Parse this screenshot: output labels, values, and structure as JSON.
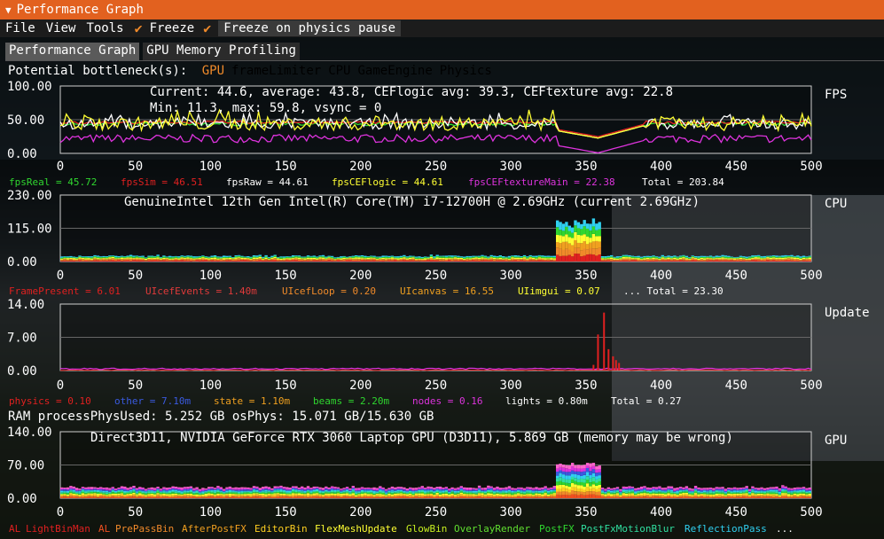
{
  "window": {
    "title": "Performance Graph"
  },
  "menu": {
    "file": "File",
    "view": "View",
    "tools": "Tools",
    "freeze": "Freeze",
    "freeze_physics": "Freeze on physics pause"
  },
  "tabs": [
    {
      "label": "Performance Graph"
    },
    {
      "label": "GPU Memory Profiling"
    }
  ],
  "bottleneck": {
    "label": "Potential bottleneck(s):",
    "items": [
      {
        "name": "GPU",
        "color": "#f08a2a"
      },
      {
        "name": "frameLimiter",
        "color": "#000000"
      },
      {
        "name": "CPU",
        "color": "#000000"
      },
      {
        "name": "GameEngine",
        "color": "#000000"
      },
      {
        "name": "Physics",
        "color": "#000000"
      }
    ]
  },
  "ram_line": "RAM  processPhysUsed: 5.252 GB  osPhys: 15.071 GB/15.630 GB",
  "graphs": [
    {
      "id": "fps",
      "side_label": "FPS",
      "ymax_label": "100.00",
      "ymid_label": "50.00",
      "ymin_label": "0.00",
      "ymax": 100,
      "info": [
        "Current: 44.6, average: 43.8, CEFlogic avg: 39.3, CEFtexture avg: 22.8",
        "Min: 11.3, max: 59.8, vsync = 0"
      ],
      "legend": [
        {
          "name": "fpsReal",
          "value": "45.72",
          "color": "#2fd62f"
        },
        {
          "name": "fpsSim",
          "value": "46.51",
          "color": "#e02020"
        },
        {
          "name": "fpsRaw",
          "value": "44.61",
          "color": "#ffffff"
        },
        {
          "name": "fpsCEFlogic",
          "value": "44.61",
          "color": "#ffff33"
        },
        {
          "name": "fpsCEFtextureMain",
          "value": "22.38",
          "color": "#dd33dd"
        }
      ],
      "total": "Total = 203.84"
    },
    {
      "id": "cpu",
      "side_label": "CPU",
      "ymax_label": "230.00",
      "ymid_label": "115.00",
      "ymin_label": "0.00",
      "ymax": 230,
      "info": [
        "GenuineIntel 12th Gen Intel(R) Core(TM) i7-12700H @ 2.69GHz (current 2.69GHz)"
      ],
      "legend": [
        {
          "name": "FramePresent",
          "value": "6.01",
          "color": "#e02020"
        },
        {
          "name": "UIcefEvents",
          "value": "1.40m",
          "color": "#e03a3a"
        },
        {
          "name": "UIcefLoop",
          "value": "0.20",
          "color": "#f08a2a"
        },
        {
          "name": "UIcanvas",
          "value": "16.55",
          "color": "#f0a020"
        },
        {
          "name": "UIimgui",
          "value": "0.07",
          "color": "#ffff33"
        }
      ],
      "total": "... Total = 23.30"
    },
    {
      "id": "update",
      "side_label": "Update",
      "ymax_label": "14.00",
      "ymid_label": "7.00",
      "ymin_label": "0.00",
      "ymax": 14,
      "info": [],
      "legend": [
        {
          "name": "physics",
          "value": "0.10",
          "color": "#e02020"
        },
        {
          "name": "other",
          "value": "7.10m",
          "color": "#3a5ae0"
        },
        {
          "name": "state",
          "value": "1.10m",
          "color": "#f0a020"
        },
        {
          "name": "beams",
          "value": "2.20m",
          "color": "#2fd62f"
        },
        {
          "name": "nodes",
          "value": "0.16",
          "color": "#dd33dd"
        },
        {
          "name": "lights",
          "value": "0.80m",
          "color": "#ffffff"
        }
      ],
      "total": "Total = 0.27"
    },
    {
      "id": "gpu",
      "side_label": "GPU",
      "ymax_label": "140.00",
      "ymid_label": "70.00",
      "ymin_label": "0.00",
      "ymax": 140,
      "info": [
        "Direct3D11, NVIDIA GeForce RTX 3060 Laptop GPU (D3D11), 5.869 GB (memory may be wrong)"
      ],
      "legend_names": [
        {
          "name": "AL",
          "color": "#e02020"
        },
        {
          "name": "LightBinMan",
          "color": "#e02020"
        },
        {
          "name": "AL",
          "color": "#f05020"
        },
        {
          "name": "PrePassBin",
          "color": "#f08a2a"
        },
        {
          "name": "AfterPostFX",
          "color": "#f0a020"
        },
        {
          "name": "EditorBin",
          "color": "#ffd020"
        },
        {
          "name": "FlexMeshUpdate",
          "color": "#ffff33"
        },
        {
          "name": "GlowBin",
          "color": "#c8f020"
        },
        {
          "name": "OverlayRender",
          "color": "#60e030"
        },
        {
          "name": "PostFX",
          "color": "#2fd62f"
        },
        {
          "name": "PostFxMotionBlur",
          "color": "#30e0a0"
        },
        {
          "name": "ReflectionPass",
          "color": "#30d0f0"
        }
      ],
      "more": "..."
    }
  ],
  "xaxis": {
    "ticks": [
      "0",
      "50",
      "100",
      "150",
      "200",
      "250",
      "300",
      "350",
      "400",
      "450",
      "500"
    ]
  }
}
